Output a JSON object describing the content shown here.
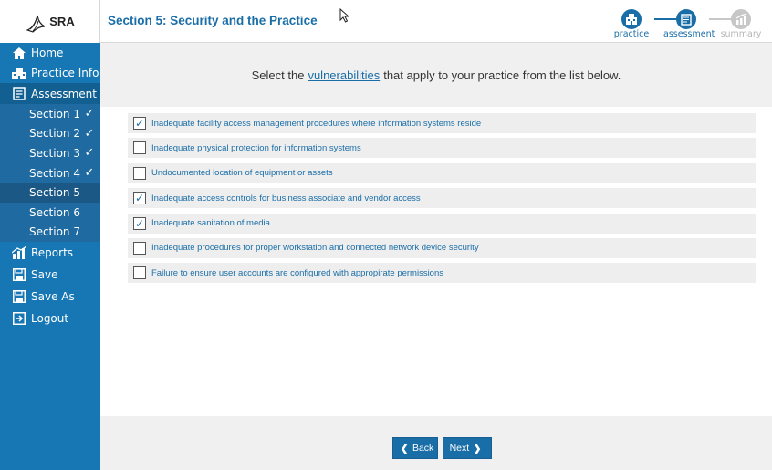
{
  "logo": {
    "text": "SRA"
  },
  "header": {
    "title": "Section 5: Security and the Practice"
  },
  "steps": [
    {
      "label": "practice",
      "state": "done"
    },
    {
      "label": "assessment",
      "state": "done"
    },
    {
      "label": "summary",
      "state": "todo"
    }
  ],
  "sidebar": {
    "home": "Home",
    "practice_info": "Practice Info",
    "assessment": "Assessment",
    "sections": [
      {
        "label": "Section 1",
        "check": "✓"
      },
      {
        "label": "Section 2",
        "check": "✓"
      },
      {
        "label": "Section 3",
        "check": "✓"
      },
      {
        "label": "Section 4",
        "check": "✓"
      },
      {
        "label": "Section 5",
        "check": ""
      },
      {
        "label": "Section 6",
        "check": ""
      },
      {
        "label": "Section 7",
        "check": ""
      }
    ],
    "reports": "Reports",
    "save": "Save",
    "save_as": "Save As",
    "logout": "Logout"
  },
  "prompt": {
    "before": "Select the",
    "link": "vulnerabilities",
    "after": "that apply to your practice from the list below."
  },
  "options": [
    {
      "text": "Inadequate facility access management procedures where information systems reside",
      "checked": true,
      "mark": "✓"
    },
    {
      "text": "Inadequate physical protection for information systems",
      "checked": false,
      "mark": ""
    },
    {
      "text": "Undocumented location of equipment or assets",
      "checked": false,
      "mark": ""
    },
    {
      "text": "Inadequate access controls for business associate and vendor access",
      "checked": true,
      "mark": "✓"
    },
    {
      "text": "Inadequate sanitation of media",
      "checked": true,
      "mark": "✓"
    },
    {
      "text": "Inadequate procedures for proper workstation and connected network device security",
      "checked": false,
      "mark": ""
    },
    {
      "text": "Failure to ensure user accounts are configured with appropirate permissions",
      "checked": false,
      "mark": ""
    }
  ],
  "buttons": {
    "back": "Back",
    "next": "Next"
  },
  "icons": {
    "logo": "hhs-eagle-icon",
    "home": "home-icon",
    "practice_info": "building-icon",
    "assessment": "clipboard-icon",
    "reports": "chart-icon",
    "save": "floppy-disk-icon",
    "save_as": "floppy-disk-icon",
    "logout": "logout-icon",
    "back": "chevron-left-icon",
    "next": "chevron-right-icon"
  },
  "colors": {
    "sidebar": "#1777b4",
    "accent": "#1a6ea8",
    "option_bg": "#eeeeee",
    "bar_bg": "#f0f0f0"
  }
}
